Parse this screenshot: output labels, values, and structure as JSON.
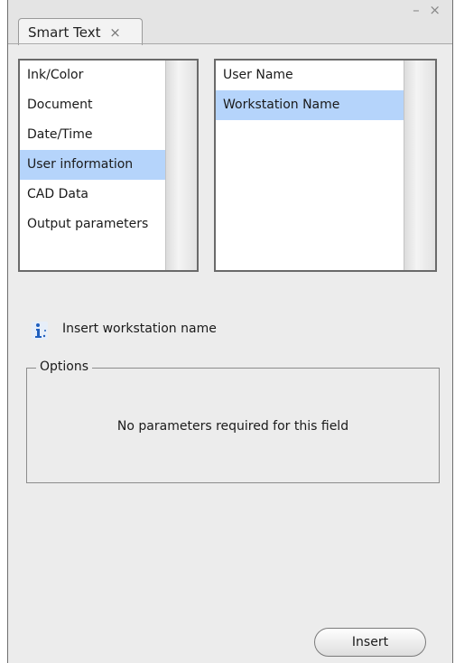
{
  "tab": {
    "title": "Smart Text",
    "close_glyph": "×"
  },
  "window_controls": {
    "minimize": "–",
    "close": "×"
  },
  "categories": {
    "items": [
      {
        "label": "Ink/Color",
        "selected": false
      },
      {
        "label": "Document",
        "selected": false
      },
      {
        "label": "Date/Time",
        "selected": false
      },
      {
        "label": "User information",
        "selected": true
      },
      {
        "label": "CAD Data",
        "selected": false
      },
      {
        "label": "Output parameters",
        "selected": false
      }
    ]
  },
  "fields": {
    "items": [
      {
        "label": "User Name",
        "selected": false
      },
      {
        "label": "Workstation Name",
        "selected": true
      }
    ]
  },
  "hint": {
    "icon": "info-icon",
    "text": "Insert workstation name"
  },
  "options": {
    "legend": "Options",
    "message": "No parameters required for this field"
  },
  "insert_button": {
    "label": "Insert"
  },
  "colors": {
    "selection": "#b5d4fb",
    "panel": "#ececec"
  }
}
